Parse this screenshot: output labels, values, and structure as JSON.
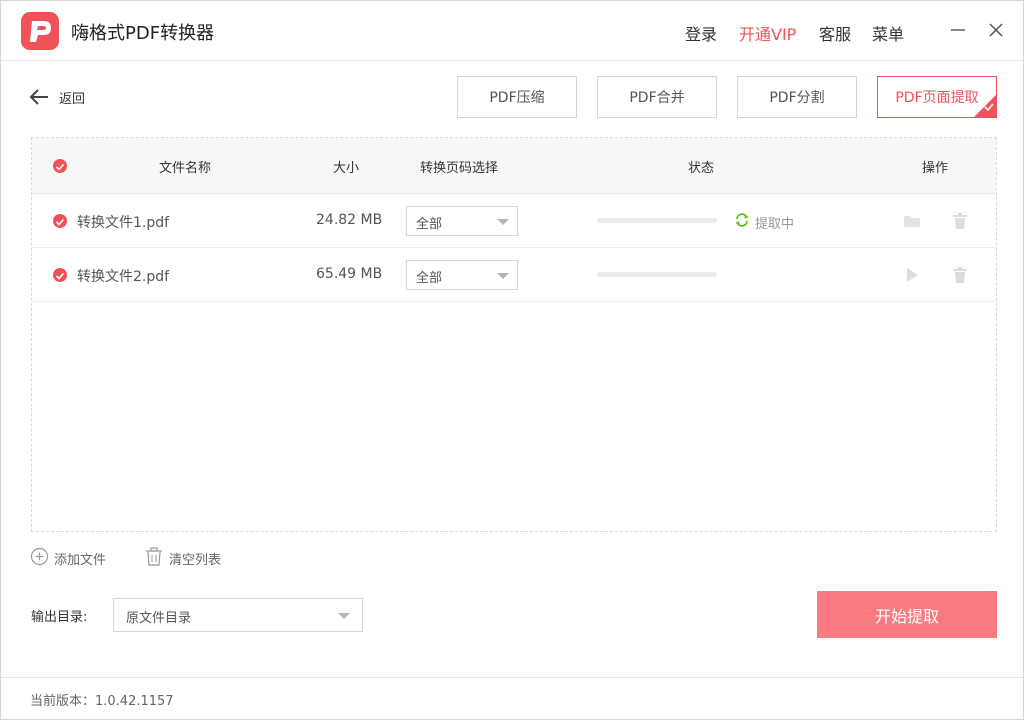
{
  "colors": {
    "accent": "#f0525a",
    "start_button": "#fa7b7f",
    "refresh_green": "#52c41a"
  },
  "titlebar": {
    "app_title": "嗨格式PDF转换器",
    "login": "登录",
    "vip": "开通VIP",
    "service": "客服",
    "menu": "菜单",
    "minimize_icon": "minus-icon",
    "close_icon": "close-icon"
  },
  "toolbar": {
    "back_label": "返回",
    "modes": [
      "PDF压缩",
      "PDF合并",
      "PDF分割",
      "PDF页面提取"
    ],
    "active_mode": "PDF页面提取"
  },
  "file_list": {
    "columns": {
      "name": "文件名称",
      "size": "大小",
      "page_select": "转换页码选择",
      "status": "状态",
      "actions": "操作"
    },
    "rows": [
      {
        "name": "转换文件1.pdf",
        "size": "24.82 MB",
        "page_select": "全部",
        "status": "提取中",
        "progress": 0,
        "actions": [
          "folder-icon",
          "trash-icon"
        ]
      },
      {
        "name": "转换文件2.pdf",
        "size": "65.49 MB",
        "page_select": "全部",
        "status": "",
        "progress": 0,
        "actions": [
          "play-icon",
          "trash-icon"
        ]
      }
    ]
  },
  "footer": {
    "add_file": "添加文件",
    "clear_list": "清空列表",
    "output_label": "输出目录:",
    "output_dir": "原文件目录",
    "start_button": "开始提取",
    "version": "当前版本：1.0.42.1157"
  }
}
